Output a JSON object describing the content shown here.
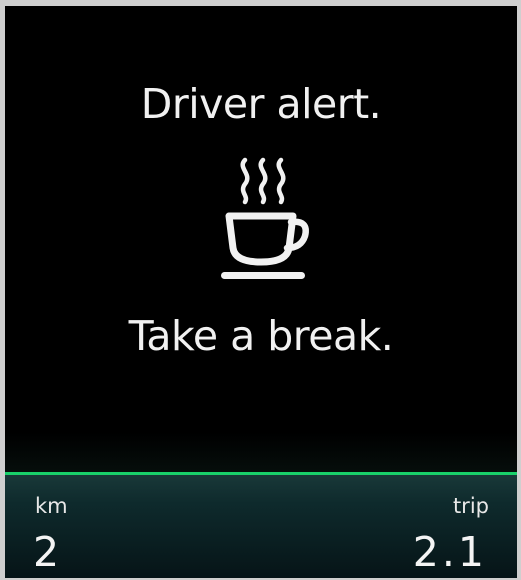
{
  "alert": {
    "title": "Driver alert.",
    "icon": "coffee-cup-icon",
    "message": "Take a break."
  },
  "info_bar": {
    "left_label": "km",
    "left_value": "2",
    "right_label": "trip",
    "right_value": "2.1"
  },
  "colors": {
    "background": "#000000",
    "text": "#f1f1f1",
    "accent_line": "#19d06a",
    "info_bar": "#0e2a2c"
  }
}
